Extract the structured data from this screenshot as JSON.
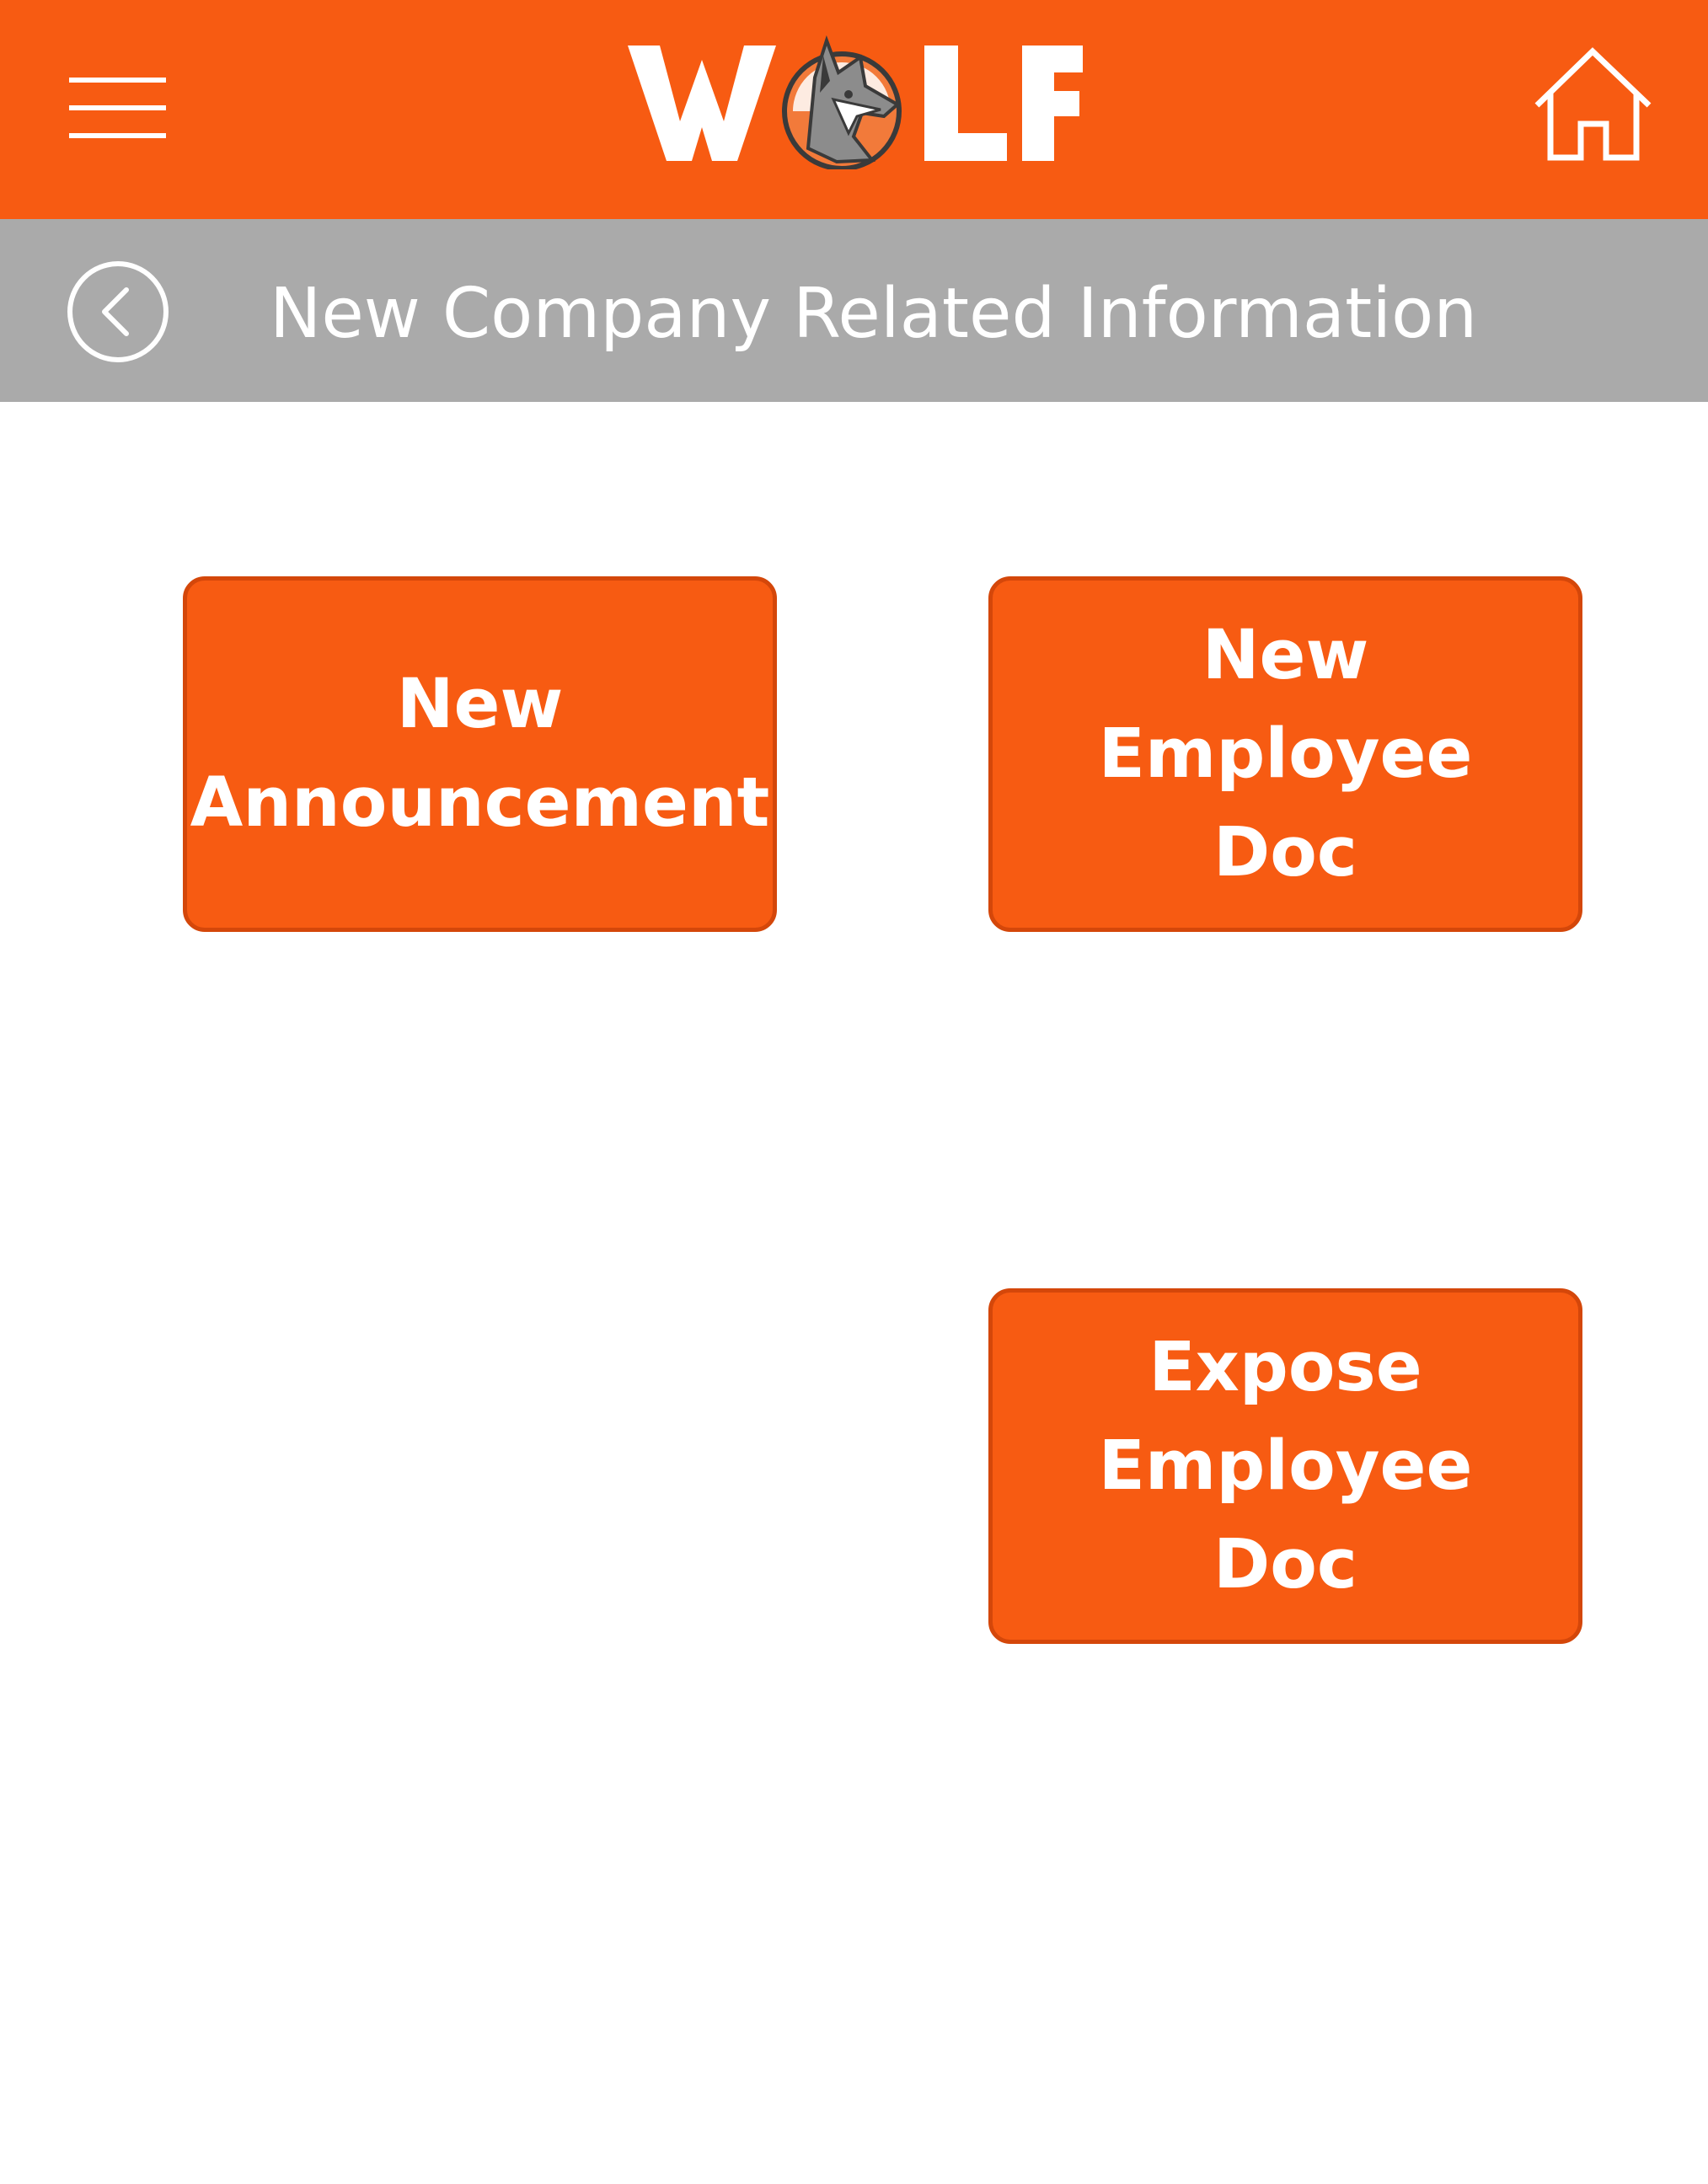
{
  "header": {
    "logo_text": "WOLF",
    "menu_icon": "hamburger-menu-icon",
    "home_icon": "home-icon",
    "background_color": "#f75b12"
  },
  "subheader": {
    "back_icon": "chevron-left-circle-icon",
    "title": "New Company Related Information",
    "background_color": "#aaaaaa"
  },
  "actions": {
    "new_announcement": "New Announcement",
    "new_employee_doc": "New Employee Doc",
    "expose_employee_doc": "Expose Employee Doc"
  },
  "colors": {
    "accent": "#f75b12",
    "button_border": "#d4470a",
    "text_on_accent": "#ffffff"
  }
}
